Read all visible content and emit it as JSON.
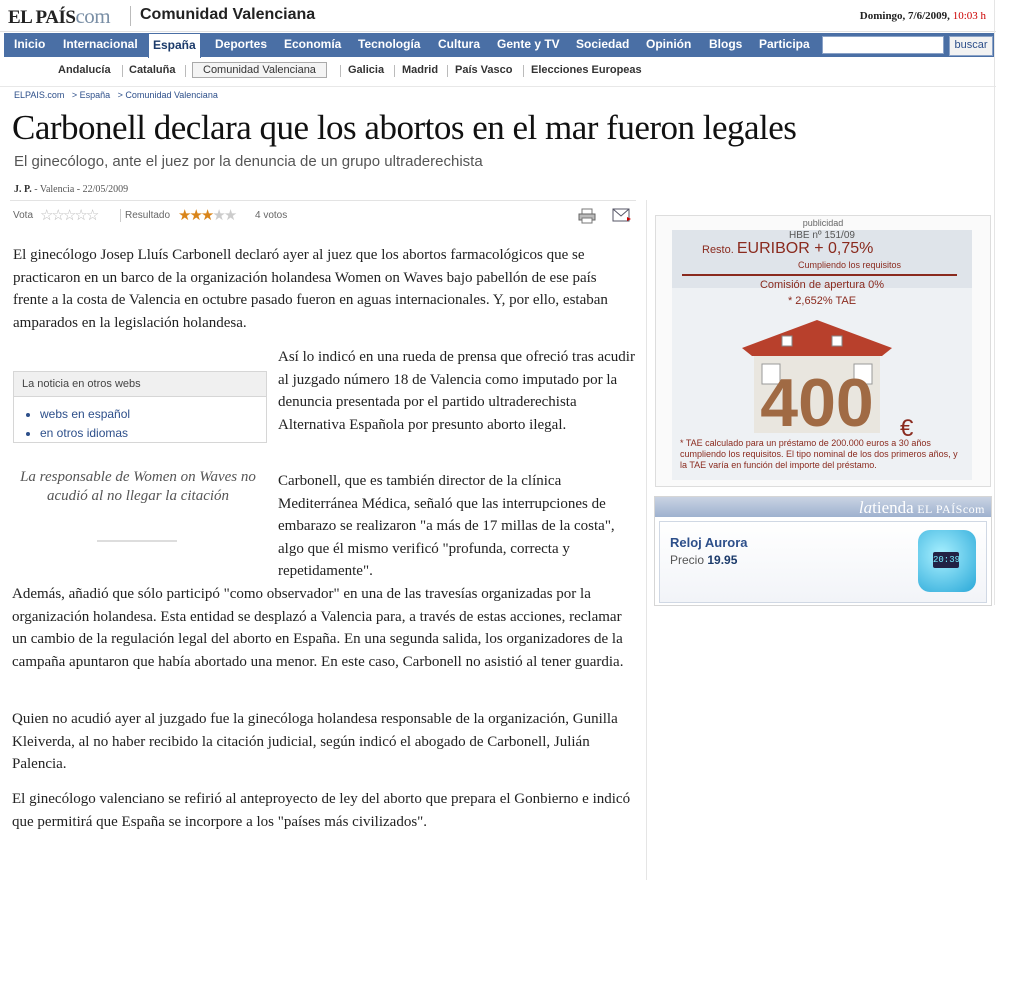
{
  "header": {
    "logo_main": "EL PAÍS",
    "logo_com": "com",
    "section": "Comunidad Valenciana",
    "date": "Domingo, 7/6/2009, ",
    "time": "10:03 h"
  },
  "nav": {
    "items": [
      "Inicio",
      "Internacional",
      "España",
      "Deportes",
      "Economía",
      "Tecnología",
      "Cultura",
      "Gente y TV",
      "Sociedad",
      "Opinión",
      "Blogs",
      "Participa"
    ],
    "search_value": "",
    "search_button": "buscar"
  },
  "subnav": {
    "items": [
      "Andalucía",
      "Cataluña",
      "Comunidad Valenciana",
      "Galicia",
      "Madrid",
      "País Vasco",
      "Elecciones Europeas"
    ]
  },
  "breadcrumb": [
    "ELPAIS.com",
    "> España",
    "> Comunidad Valenciana"
  ],
  "article": {
    "title": "Carbonell declara que los abortos en el mar fueron legales",
    "subtitle": "El ginecólogo, ante el juez por la denuncia de un grupo ultraderechista",
    "author": "J. P.",
    "byline_rest": " - Valencia - 22/05/2009",
    "vote_label": "Vota",
    "result_label": "Resultado",
    "rating": 3,
    "rating_max": 5,
    "votes_text": "4 votos",
    "p1": "El ginecólogo Josep Lluís Carbonell declaró ayer al juez que los abortos farmacológicos que se practicaron en un barco de la organización holandesa Women on Waves bajo pabellón de ese país frente a la costa de Valencia en octubre pasado fueron en aguas internacionales. Y, por ello, estaban amparados en la legislación holandesa.",
    "p2": "Así lo indicó en una rueda de prensa que ofreció tras acudir al juzgado número 18 de Valencia como imputado por la denuncia presentada por el partido ultraderechista Alternativa Española por presunto aborto ilegal.",
    "p3": "Carbonell, que es también director de la clínica Mediterránea Médica, señaló que las interrupciones de embarazo se realizaron \"a más de 17 millas de la costa\", algo que él mismo verificó \"profunda, correcta y repetidamente\".",
    "p4": "Además, añadió que sólo participó \"como observador\" en una de las travesías organizadas por la organización holandesa. Esta entidad se desplazó a Valencia para, a través de estas acciones, reclamar un cambio de la regulación legal del aborto en España. En una segunda salida, los organizadores de la campaña apuntaron que había abortado una menor. En este caso, Carbonell no asistió al tener guardia.",
    "p5": "Quien no acudió ayer al juzgado fue la ginecóloga holandesa responsable de la organización, Gunilla Kleiverda, al no haber recibido la citación judicial, según indicó el abogado de Carbonell, Julián Palencia.",
    "p6": "El ginecólogo valenciano se refirió al anteproyecto de ley del aborto que prepara el Gonbierno e indicó que permitirá que España se incorpore a los \"países más civilizados\".",
    "quote": "La responsable de Women on Waves no acudió al no llegar la citación"
  },
  "other_webs": {
    "title": "La noticia en otros webs",
    "links": [
      "webs en español",
      "en otros idiomas"
    ]
  },
  "ad": {
    "label": "publicidad",
    "hbe": "HBE nº 151/09",
    "resto": "Resto. ",
    "euribor": "EURIBOR + 0,75%",
    "requisitos": "Cumpliendo los requisitos",
    "comision": "Comisión de apertura 0%",
    "tae": "* 2,652% TAE",
    "amount": "400",
    "footnote": "* TAE calculado para un préstamo de 200.000 euros a 30 años cumpliendo los requisitos. El tipo nominal de los dos primeros años, y la TAE varía en función del importe del préstamo."
  },
  "shop": {
    "brand_la": "la",
    "brand_tienda": "tienda",
    "brand_elpais": " EL PAÍS",
    "brand_com": "com",
    "product": "Reloj Aurora",
    "price_label": "Precio ",
    "price": "19.95",
    "clock_screen": "20:39"
  },
  "colors": {
    "nav_blue": "#4a6fa5",
    "link_blue": "#2d4f8a",
    "star_orange": "#d9851b",
    "ad_red": "#8a2a1e",
    "time_red": "#cc0000"
  }
}
